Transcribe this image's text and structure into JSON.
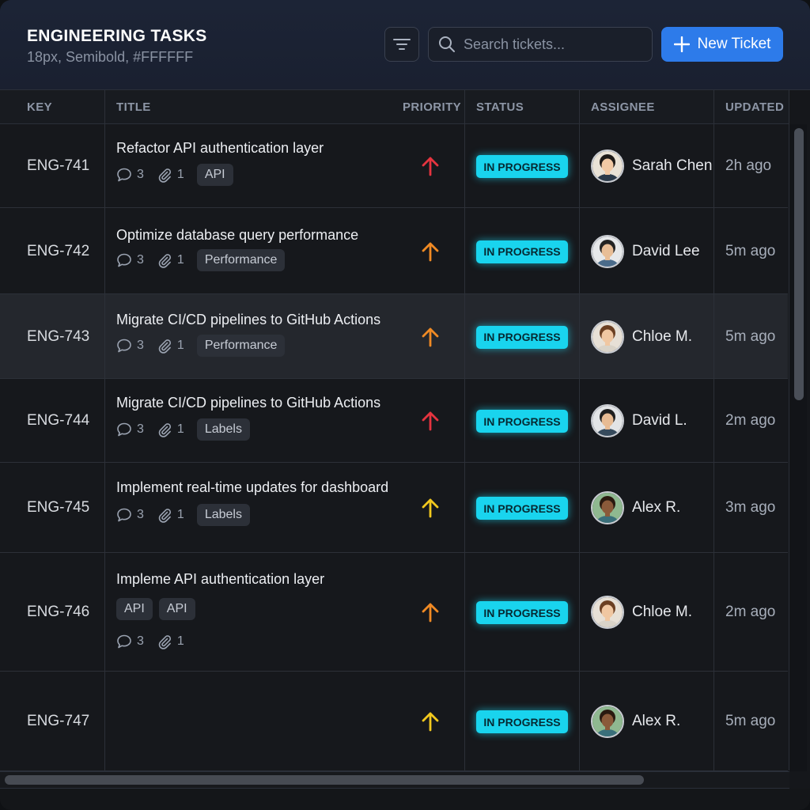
{
  "header": {
    "title": "ENGINEERING TASKS",
    "subtitle": "18px, Semibold, #FFFFFF",
    "search_placeholder": "Search tickets...",
    "new_ticket_label": "New Ticket"
  },
  "columns": {
    "key": "KEY",
    "title": "TITLE",
    "priority": "PRIORITY",
    "status": "STATUS",
    "assignee": "ASSIGNEE",
    "updated": "UPDATED"
  },
  "colors": {
    "accent": "#2d7bea",
    "status": "#19d4ee",
    "priority_high": "#e5343f",
    "priority_medium": "#f08a24",
    "priority_low": "#f2c81e"
  },
  "rows": [
    {
      "key": "ENG-741",
      "title": "Refactor API authentication layer",
      "comments": "3",
      "attachments": "1",
      "tags": [
        "API"
      ],
      "priority": "high",
      "status": "IN PROGRESS",
      "assignee": "Sarah Chen",
      "updated": "2h ago"
    },
    {
      "key": "ENG-742",
      "title": "Optimize database query performance",
      "comments": "3",
      "attachments": "1",
      "tags": [
        "Performance"
      ],
      "priority": "medium",
      "status": "IN PROGRESS",
      "assignee": "David Lee",
      "updated": "5m ago"
    },
    {
      "key": "ENG-743",
      "title": "Migrate CI/CD pipelines to GitHub Actions",
      "comments": "3",
      "attachments": "1",
      "tags": [
        "Performance"
      ],
      "priority": "medium",
      "status": "IN PROGRESS",
      "assignee": "Chloe M.",
      "updated": "5m ago"
    },
    {
      "key": "ENG-744",
      "title": "Migrate CI/CD pipelines to GitHub Actions",
      "comments": "3",
      "attachments": "1",
      "tags": [
        "Labels"
      ],
      "priority": "high",
      "status": "IN PROGRESS",
      "assignee": "David L.",
      "updated": "2m ago"
    },
    {
      "key": "ENG-745",
      "title": "Implement real-time updates for dashboard",
      "comments": "3",
      "attachments": "1",
      "tags": [
        "Labels"
      ],
      "priority": "low",
      "status": "IN PROGRESS",
      "assignee": "Alex R.",
      "updated": "3m ago"
    },
    {
      "key": "ENG-746",
      "title": "Impleme API authentication layer",
      "comments": "3",
      "attachments": "1",
      "tags": [
        "API",
        "API"
      ],
      "priority": "medium",
      "status": "IN PROGRESS",
      "assignee": "Chloe M.",
      "updated": "2m ago"
    },
    {
      "key": "ENG-747",
      "title": "",
      "priority": "low",
      "status": "IN PROGRESS",
      "assignee": "Alex R.",
      "updated": "5m ago"
    }
  ]
}
